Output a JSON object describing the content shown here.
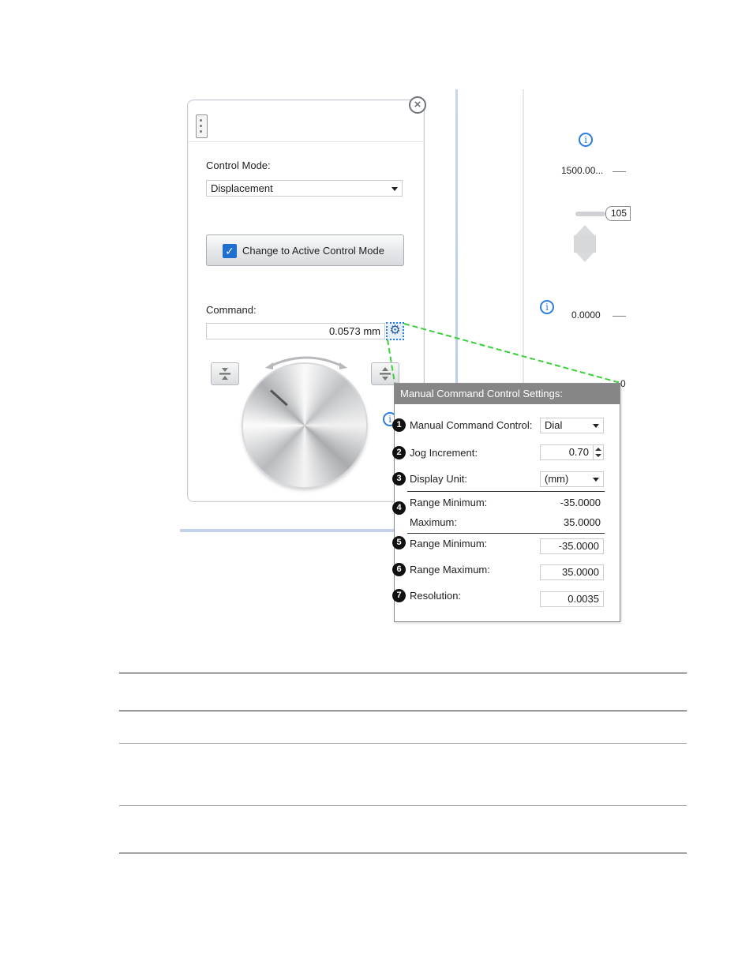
{
  "panel": {
    "control_mode_label": "Control Mode:",
    "control_mode_value": "Displacement",
    "change_mode_button": "Change to Active Control Mode",
    "command_label": "Command:",
    "command_value": "0.0573 mm"
  },
  "background": {
    "value_top": "1500.00...",
    "tag_value": "105",
    "value_mid": "0.0000",
    "value_edge": "0"
  },
  "popup": {
    "title": "Manual Command Control Settings:",
    "rows": [
      {
        "num": "1",
        "label": "Manual Command Control:",
        "value": "Dial"
      },
      {
        "num": "2",
        "label": "Jog Increment:",
        "value": "0.70"
      },
      {
        "num": "3",
        "label": "Display Unit:",
        "value": "(mm)"
      },
      {
        "num": "4",
        "label": "Range Minimum:",
        "value": "-35.0000",
        "label2": "Maximum:",
        "value2": "35.0000"
      },
      {
        "num": "5",
        "label": "Range Minimum:",
        "value": "-35.0000"
      },
      {
        "num": "6",
        "label": "Range Maximum:",
        "value": "35.0000"
      },
      {
        "num": "7",
        "label": "Resolution:",
        "value": "0.0035"
      }
    ]
  },
  "colors": {
    "accent": "#2a7de1",
    "callout": "#39d039",
    "popup_header": "#868686"
  }
}
